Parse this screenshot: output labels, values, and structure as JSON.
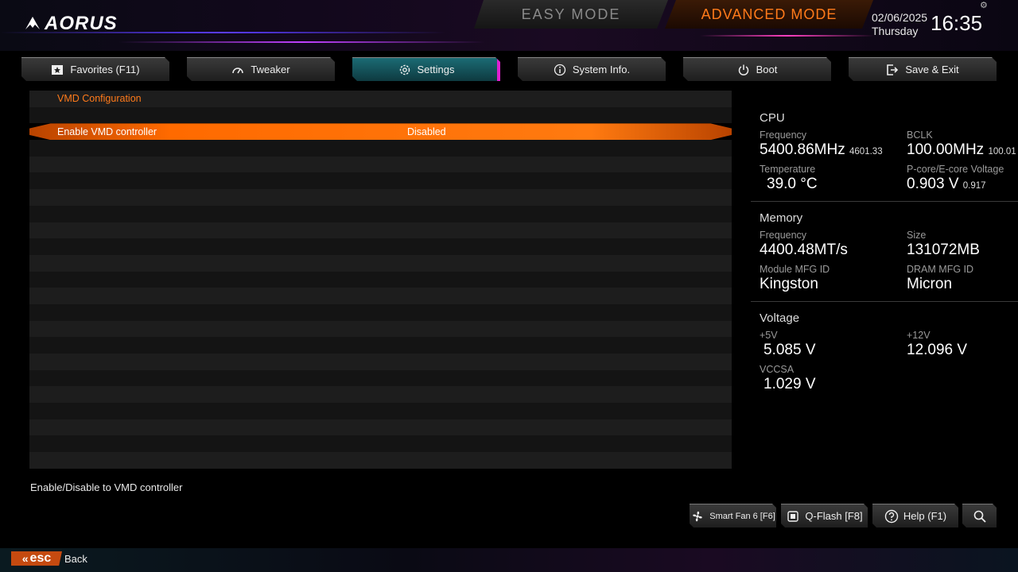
{
  "header": {
    "logo": "AORUS",
    "easy_mode": "EASY MODE",
    "advanced_mode": "ADVANCED MODE",
    "date": "02/06/2025",
    "day": "Thursday",
    "time": "16:35"
  },
  "tabs": [
    {
      "label": "Favorites (F11)",
      "icon": "star-icon"
    },
    {
      "label": "Tweaker",
      "icon": "gauge-icon"
    },
    {
      "label": "Settings",
      "icon": "gear-icon",
      "active": true
    },
    {
      "label": "System Info.",
      "icon": "info-icon"
    },
    {
      "label": "Boot",
      "icon": "power-icon"
    },
    {
      "label": "Save & Exit",
      "icon": "exit-icon"
    }
  ],
  "list": {
    "heading": "VMD Configuration",
    "items": [
      {
        "label": "Enable VMD controller",
        "value": "Disabled"
      }
    ]
  },
  "help_text": "Enable/Disable to VMD controller",
  "panel": {
    "cpu": {
      "title": "CPU",
      "frequency_label": "Frequency",
      "frequency": "5400.86MHz",
      "frequency_sub": "4601.33",
      "bclk_label": "BCLK",
      "bclk": "100.00MHz",
      "bclk_sub": "100.01",
      "temp_label": "Temperature",
      "temp": "39.0 °C",
      "voltage_label": "P-core/E-core Voltage",
      "voltage": "0.903 V",
      "voltage_sub": "0.917"
    },
    "memory": {
      "title": "Memory",
      "frequency_label": "Frequency",
      "frequency": "4400.48MT/s",
      "size_label": "Size",
      "size": "131072MB",
      "module_label": "Module MFG ID",
      "module": "Kingston",
      "dram_label": "DRAM MFG ID",
      "dram": "Micron"
    },
    "voltage": {
      "title": "Voltage",
      "v5_label": "+5V",
      "v5": "5.085 V",
      "v12_label": "+12V",
      "v12": "12.096 V",
      "vccsa_label": "VCCSA",
      "vccsa": "1.029 V"
    }
  },
  "bottom": {
    "smart_fan": "Smart Fan 6 [F6]",
    "qflash": "Q-Flash [F8]",
    "help": "Help (F1)"
  },
  "footer": {
    "esc": "esc",
    "back": "Back"
  },
  "colors": {
    "accent": "#ff7a1a",
    "active_tab": "#1b6b74",
    "selected_row": "#ff6a00"
  }
}
